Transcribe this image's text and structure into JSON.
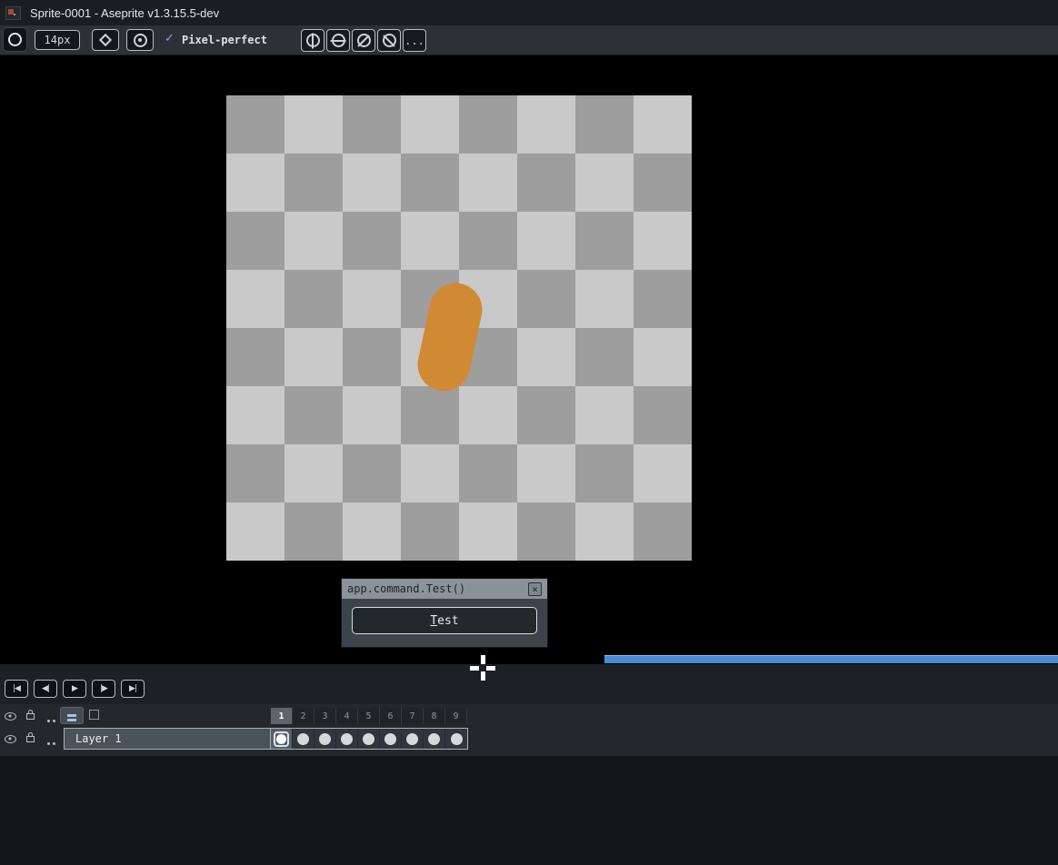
{
  "window": {
    "title": "Sprite-0001 - Aseprite v1.3.15.5-dev"
  },
  "toolbar": {
    "size_value": "14px",
    "pixel_perfect": {
      "check": "✓",
      "label": "Pixel-perfect"
    },
    "more": "..."
  },
  "canvas": {
    "checker_light": "#c9c9c9",
    "checker_dark": "#9e9e9e",
    "paint_color": "#d08a33",
    "grid_cols": 8,
    "grid_rows": 8
  },
  "dialog": {
    "title": "app.command.Test()",
    "close": "×",
    "button": {
      "head": "T",
      "tail": "est"
    }
  },
  "playback": {
    "glyphs": [
      "|◀",
      "◀|",
      "▶",
      "|▶",
      "▶|"
    ],
    "names": [
      "first-frame",
      "previous-frame",
      "play",
      "next-frame",
      "last-frame"
    ]
  },
  "timeline": {
    "frames": [
      "1",
      "2",
      "3",
      "4",
      "5",
      "6",
      "7",
      "8",
      "9"
    ],
    "selected_frame_index": 0,
    "layers": [
      {
        "name": "Layer 1",
        "cels": 9,
        "selected_cel_index": 0
      }
    ]
  },
  "icons": {
    "brush-circle": "ring",
    "ink-bucket": "diamond",
    "dynamics": "ring-dot",
    "symmetry-vertical": "circle-vline",
    "symmetry-horizontal": "circle-hline",
    "symmetry-diagonal": "circle-slash",
    "symmetry-antidiagonal": "circle-backslash",
    "eye": "ellipse-dot",
    "lock": "padlock",
    "cel": "filled-circle",
    "close": "×",
    "check": "✓"
  },
  "colors": {
    "scrollbar_thumb": "#4a8ad6",
    "selection_ring": "#d9e5ef",
    "toolbar_bg": "#2c3136",
    "workspace_bg": "#000000"
  }
}
